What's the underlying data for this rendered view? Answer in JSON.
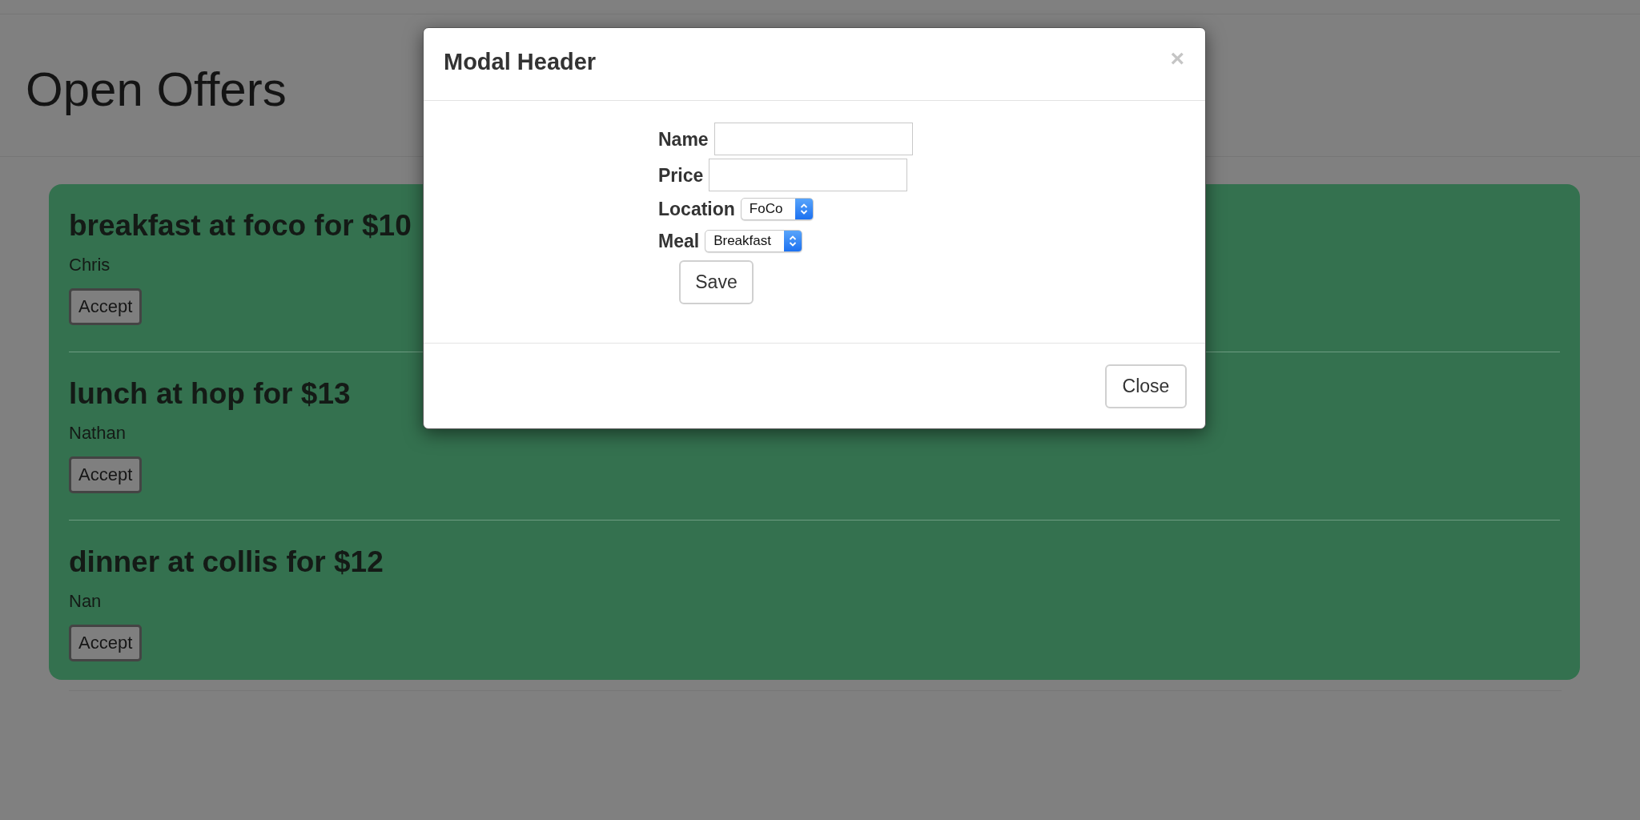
{
  "page": {
    "title": "Open Offers"
  },
  "offers": [
    {
      "title": "breakfast at foco for $10",
      "name": "Chris",
      "button": "Accept"
    },
    {
      "title": "lunch at hop for $13",
      "name": "Nathan",
      "button": "Accept"
    },
    {
      "title": "dinner at collis for $12",
      "name": "Nan",
      "button": "Accept"
    }
  ],
  "modal": {
    "title": "Modal Header",
    "close_icon": "×",
    "fields": [
      {
        "kind": "text",
        "label": "Name"
      },
      {
        "kind": "text",
        "label": "Price"
      },
      {
        "kind": "select",
        "label": "Location",
        "value": "FoCo"
      },
      {
        "kind": "select",
        "label": "Meal",
        "value": "Breakfast"
      }
    ],
    "save_button": "Save",
    "close_button": "Close"
  }
}
